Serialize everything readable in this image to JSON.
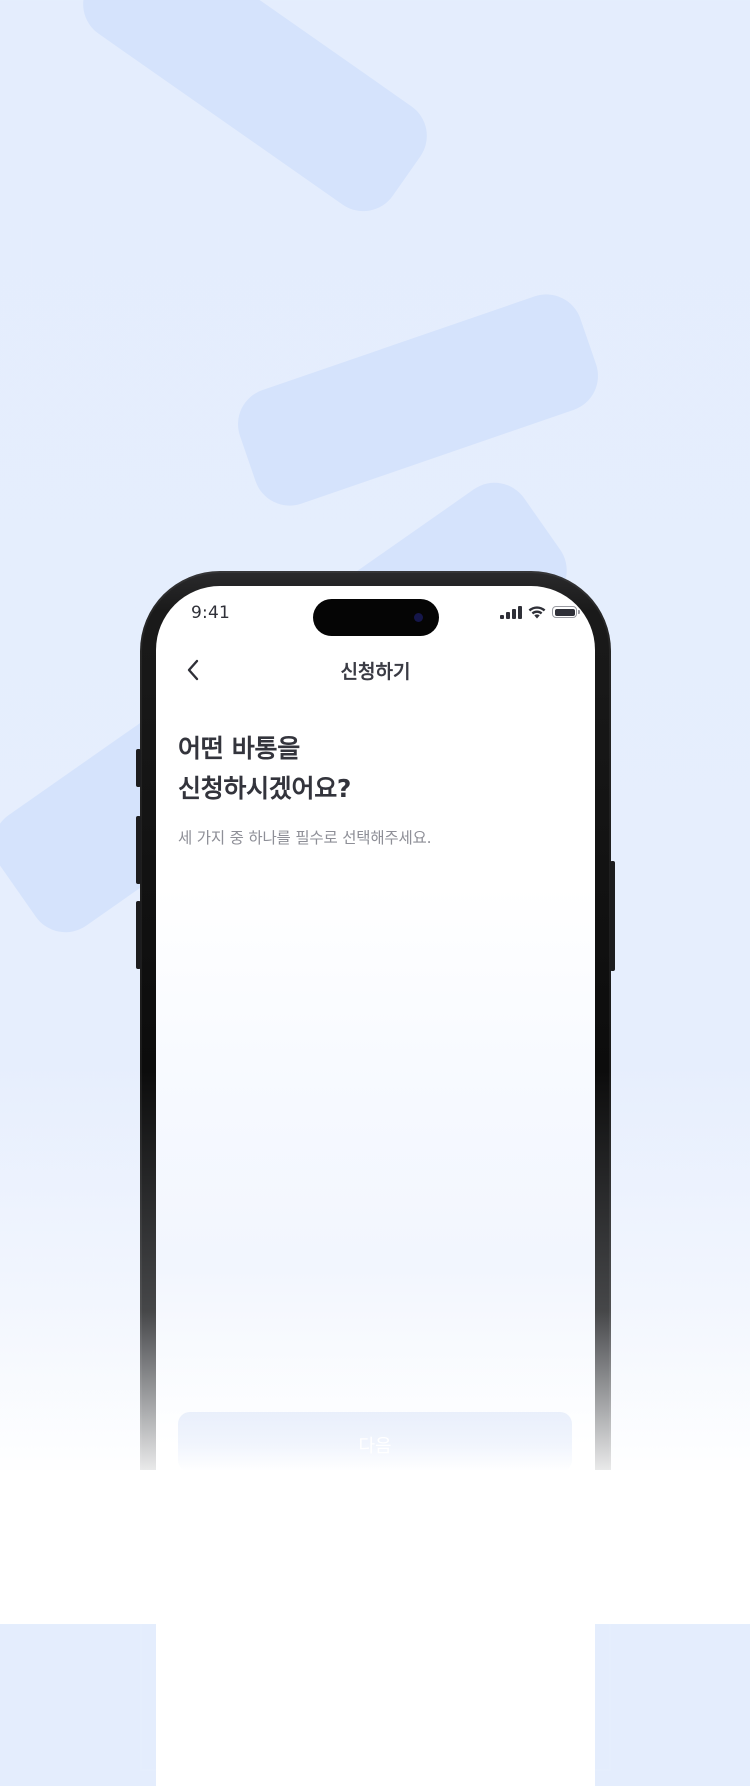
{
  "status_bar": {
    "time": "9:41",
    "icons": [
      "cellular-signal-icon",
      "wifi-icon",
      "battery-icon"
    ]
  },
  "nav": {
    "back_icon": "chevron-left-icon",
    "title": "신청하기"
  },
  "content": {
    "heading_line1": "어떤 바통을",
    "heading_line2": "신청하시겠어요?",
    "subtext": "세 가지 중 하나를 필수로 선택해주세요."
  },
  "footer": {
    "next_label": "다음"
  },
  "colors": {
    "background": "#e4edfd",
    "decor_bar": "#d5e3fc",
    "heading_text": "#33343c",
    "sub_text": "#8e8f97",
    "disabled_button": "#e9effb"
  }
}
